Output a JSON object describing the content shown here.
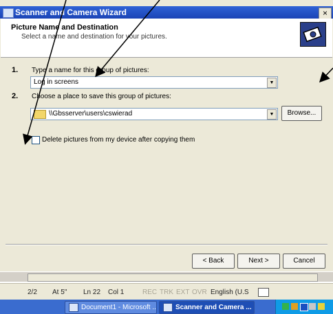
{
  "window": {
    "title": "Scanner and Camera Wizard",
    "close_glyph": "×"
  },
  "header": {
    "title": "Picture Name and Destination",
    "subtitle": "Select a name and destination for your pictures."
  },
  "steps": [
    {
      "number": "1.",
      "label": "Type a name for this group of pictures:",
      "value": "Log in screens"
    },
    {
      "number": "2.",
      "label": "Choose a place to save this group of pictures:",
      "value": "\\\\Gbsserver\\users\\cswierad"
    }
  ],
  "browse_label": "Browse...",
  "checkbox": {
    "label": "Delete pictures from my device after copying them",
    "checked": false
  },
  "footer_buttons": {
    "back": "< Back",
    "next": "Next >",
    "cancel": "Cancel"
  },
  "word_status": {
    "page": "2/2",
    "at": "At 5\"",
    "ln": "Ln 22",
    "col": "Col 1",
    "rec": "REC",
    "trk": "TRK",
    "ext": "EXT",
    "ovr": "OVR",
    "language": "English (U.S"
  },
  "taskbar": {
    "items": [
      {
        "label": "Document1 - Microsoft ...",
        "active": false
      },
      {
        "label": "Scanner and Camera ...",
        "active": true
      }
    ]
  },
  "icons": [
    "scanner-window-icon",
    "wizard-camera-icon",
    "folder-icon",
    "dropdown-arrow-icon",
    "word-doc-icon",
    "tray-icons"
  ],
  "colors": {
    "titlebar": "#2f62d6",
    "dialog_bg": "#ece9d8",
    "taskbar": "#3a6ccf"
  }
}
